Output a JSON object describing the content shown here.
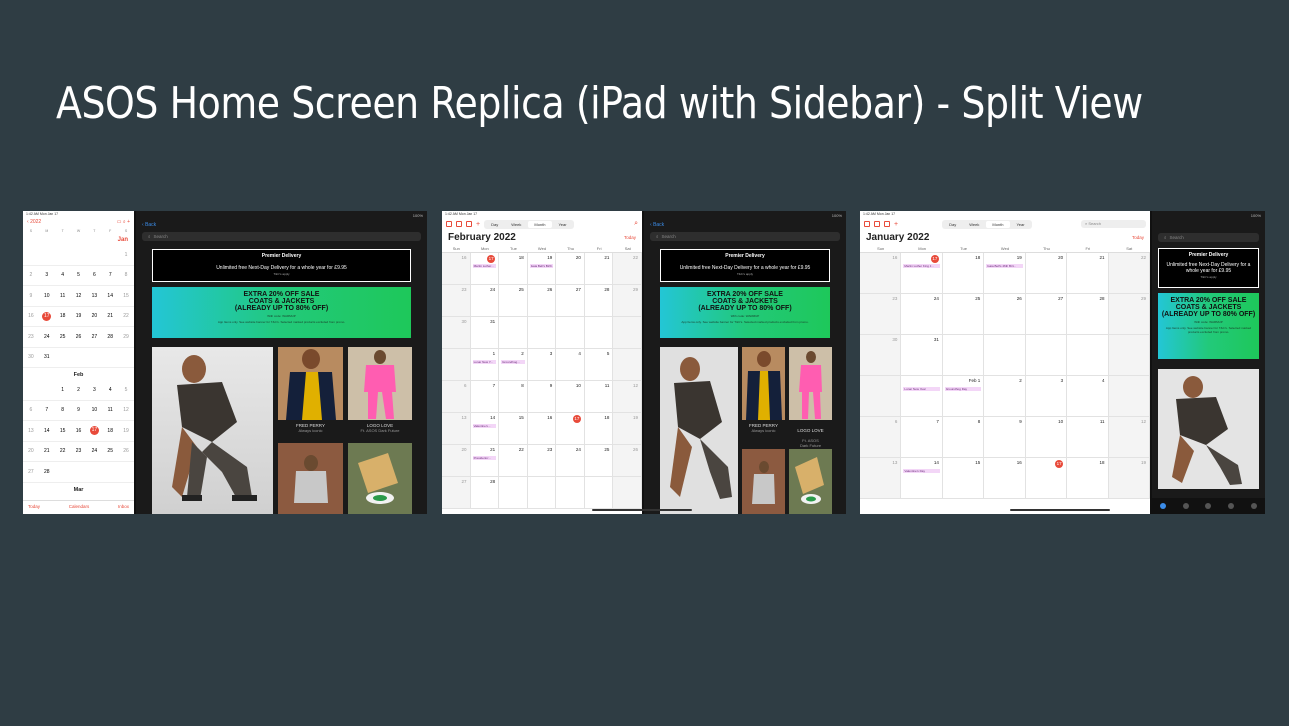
{
  "slide": {
    "title": "ASOS Home Screen Replica (iPad with Sidebar) - Split View"
  },
  "status": {
    "time": "1:42 AM",
    "date": "Mon Jan 17",
    "battery": "100%"
  },
  "asos": {
    "back": "Back",
    "search_placeholder": "Search",
    "premier_title": "Premier Delivery",
    "premier_text": "Unlimited free Next-Day Delivery for a whole year for £9.95",
    "premier_small": "T&C's apply",
    "sale_line1": "EXTRA 20% OFF SALE",
    "sale_line2": "COATS & JACKETS",
    "sale_line3": "(ALREADY UP TO 80% OFF)",
    "sale_code": "With code: WARMUP",
    "sale_note": "App Items only. See website banner for T&C's. Selected marked products excluded from promo.",
    "tile1_title": "FRED PERRY",
    "tile1_sub": "Always iconic",
    "tile2_title": "LOGO LOVE",
    "tile2_sub": "Ft. ASOS Dark Future",
    "tile2_sub_b": "Ft. ASOS\nDark Future"
  },
  "calendar": {
    "views": [
      "Day",
      "Week",
      "Month",
      "Year"
    ],
    "selected_view": "Month",
    "today_label": "Today",
    "search_placeholder": "Search",
    "weekdays": [
      "Sun",
      "Mon",
      "Tue",
      "Wed",
      "Thu",
      "Fri",
      "Sat"
    ],
    "weekdays_short": [
      "S",
      "M",
      "T",
      "W",
      "T",
      "F",
      "S"
    ],
    "feb_title": "February 2022",
    "jan_title": "January 2022",
    "events": {
      "mlk": "Martin Luther King Jr. Day",
      "mlk_short": "Martin Luther...",
      "mlk_short2": "Martin Luther King J...",
      "bday": "Isaia Bell's Birth...",
      "bday2": "Isaia Bell's 46th Birt...",
      "lunar": "Lunar New Year",
      "lunar_short": "Lunar New Y...",
      "groundhog": "Groundhog Day",
      "groundhog_short": "Groundhog...",
      "valentines": "Valentine's Day",
      "valentines_short": "Valentine's...",
      "presidents": "Presidents'...",
      "feb1": "Feb 1"
    },
    "mini": {
      "jan": "Jan",
      "feb": "Feb",
      "mar": "Mar",
      "year": "2022",
      "bottom": [
        "Today",
        "Calendars",
        "Inbox"
      ]
    }
  }
}
